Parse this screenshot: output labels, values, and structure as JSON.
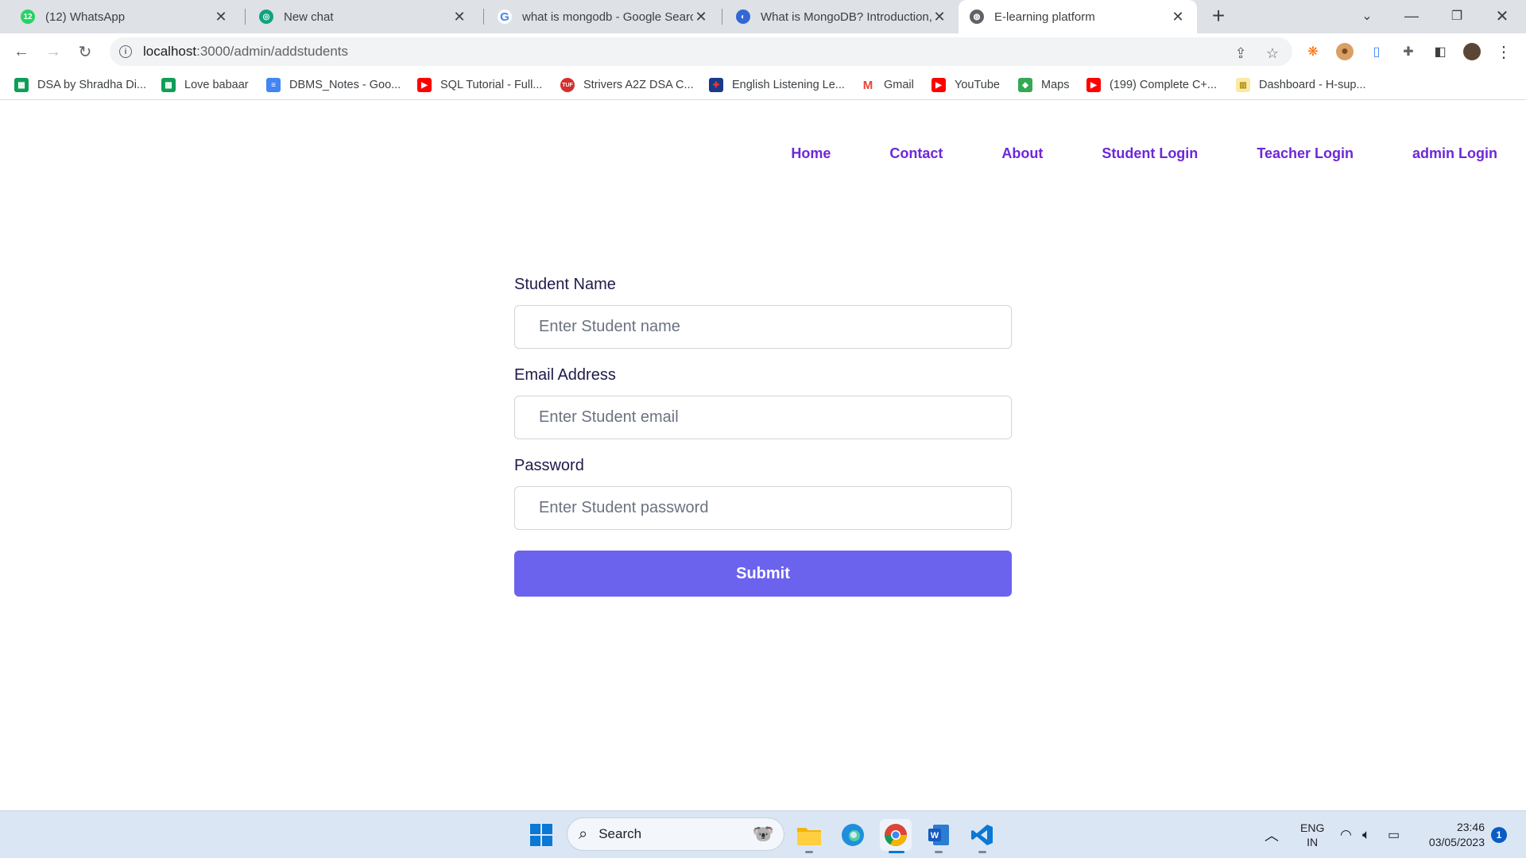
{
  "browser": {
    "tabs": [
      {
        "title": "(12) WhatsApp",
        "favicon": "whatsapp-icon",
        "badge": "12"
      },
      {
        "title": "New chat",
        "favicon": "chatgpt-icon"
      },
      {
        "title": "what is mongodb - Google Search",
        "favicon": "google-icon"
      },
      {
        "title": "What is MongoDB? Introduction,",
        "favicon": "web-icon"
      },
      {
        "title": "E-learning platform",
        "favicon": "globe-icon",
        "active": true
      }
    ],
    "url_host": "localhost",
    "url_path": ":3000/admin/addstudents",
    "bookmarks": [
      {
        "label": "DSA by Shradha Di...",
        "icon": "sheets-icon"
      },
      {
        "label": "Love babaar",
        "icon": "sheets-icon"
      },
      {
        "label": "DBMS_Notes - Goo...",
        "icon": "docs-icon"
      },
      {
        "label": "SQL Tutorial - Full...",
        "icon": "youtube-icon"
      },
      {
        "label": "Strivers A2Z DSA C...",
        "icon": "tuf-icon",
        "icon_text": "TUF"
      },
      {
        "label": "English Listening Le...",
        "icon": "uk-flag-icon"
      },
      {
        "label": "Gmail",
        "icon": "gmail-icon"
      },
      {
        "label": "YouTube",
        "icon": "youtube-icon"
      },
      {
        "label": "Maps",
        "icon": "maps-icon"
      },
      {
        "label": "(199) Complete C+...",
        "icon": "youtube-icon"
      },
      {
        "label": "Dashboard - H-sup...",
        "icon": "dashboard-icon"
      }
    ]
  },
  "site": {
    "nav": [
      "Home",
      "Contact",
      "About",
      "Student Login",
      "Teacher Login",
      "admin Login"
    ],
    "form": {
      "name_label": "Student Name",
      "name_placeholder": "Enter Student name",
      "email_label": "Email Address",
      "email_placeholder": "Enter Student email",
      "password_label": "Password",
      "password_placeholder": "Enter Student password",
      "submit_label": "Submit"
    },
    "colors": {
      "nav": "#6d28d9",
      "button": "#6b63ee",
      "label": "#1e1b4b"
    }
  },
  "taskbar": {
    "search_label": "Search",
    "lang_line1": "ENG",
    "lang_line2": "IN",
    "time": "23:46",
    "date": "03/05/2023",
    "notification_count": "1"
  }
}
